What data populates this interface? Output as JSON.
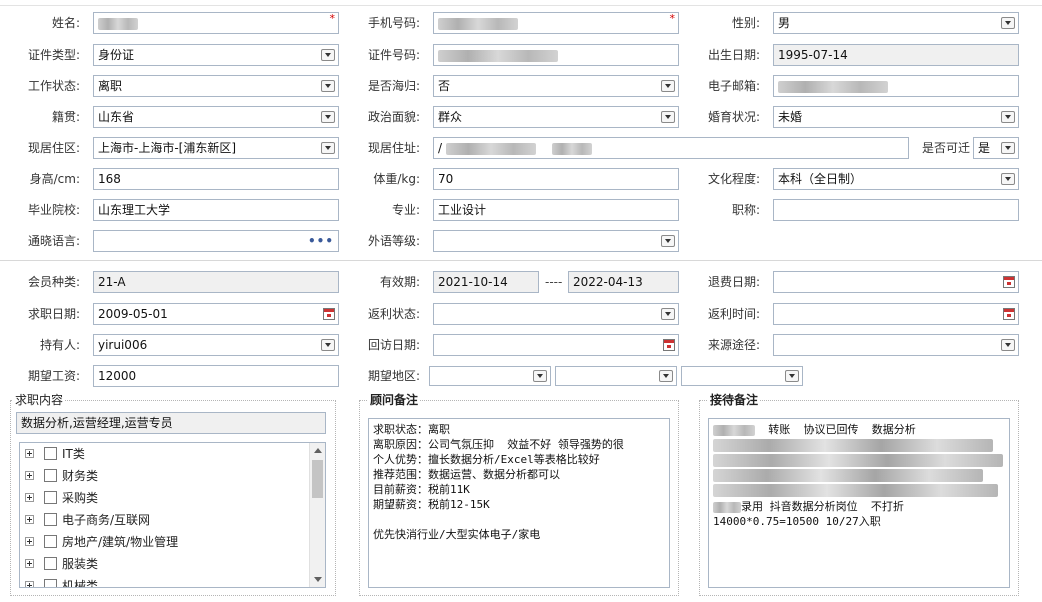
{
  "basic": {
    "name": {
      "label": "姓名:",
      "value": ""
    },
    "phone": {
      "label": "手机号码:",
      "value": ""
    },
    "gender": {
      "label": "性别:",
      "value": "男"
    },
    "id_type": {
      "label": "证件类型:",
      "value": "身份证"
    },
    "id_no": {
      "label": "证件号码:",
      "value": ""
    },
    "birth": {
      "label": "出生日期:",
      "value": "1995-07-14"
    },
    "work_status": {
      "label": "工作状态:",
      "value": "离职"
    },
    "overseas": {
      "label": "是否海归:",
      "value": "否"
    },
    "email": {
      "label": "电子邮箱:",
      "value": ""
    },
    "native": {
      "label": "籍贯:",
      "value": "山东省"
    },
    "political": {
      "label": "政治面貌:",
      "value": "群众"
    },
    "marital": {
      "label": "婚育状况:",
      "value": "未婚"
    },
    "district": {
      "label": "现居住区:",
      "value": "上海市-上海市-[浦东新区]"
    },
    "address": {
      "label": "现居住址:",
      "value": "/"
    },
    "relocate": {
      "label": "是否可迁",
      "value": "是"
    },
    "height": {
      "label": "身高/cm:",
      "value": "168"
    },
    "weight": {
      "label": "体重/kg:",
      "value": "70"
    },
    "education": {
      "label": "文化程度:",
      "value": "本科（全日制）"
    },
    "school": {
      "label": "毕业院校:",
      "value": "山东理工大学"
    },
    "major": {
      "label": "专业:",
      "value": "工业设计"
    },
    "title": {
      "label": "职称:",
      "value": ""
    },
    "language": {
      "label": "通晓语言:",
      "value": "",
      "dots": "•••"
    },
    "foreign_level": {
      "label": "外语等级:",
      "value": ""
    }
  },
  "member": {
    "type": {
      "label": "会员种类:",
      "value": "21-A"
    },
    "validity": {
      "label": "有效期:",
      "start": "2021-10-14",
      "sep": "----",
      "end": "2022-04-13"
    },
    "refund_date": {
      "label": "退费日期:",
      "value": ""
    },
    "apply_date": {
      "label": "求职日期:",
      "value": "2009-05-01"
    },
    "rebate_status": {
      "label": "返利状态:",
      "value": ""
    },
    "rebate_time": {
      "label": "返利时间:",
      "value": ""
    },
    "holder": {
      "label": "持有人:",
      "value": "yirui006"
    },
    "visit_date": {
      "label": "回访日期:",
      "value": ""
    },
    "source": {
      "label": "来源途径:",
      "value": ""
    },
    "salary": {
      "label": "期望工资:",
      "value": "12000"
    },
    "area": {
      "label": "期望地区:",
      "values": [
        "",
        "",
        ""
      ]
    }
  },
  "job_panel": {
    "title": "求职内容",
    "summary": "数据分析,运营经理,运营专员",
    "categories": [
      "IT类",
      "财务类",
      "采购类",
      "电子商务/互联网",
      "房地产/建筑/物业管理",
      "服装类",
      "机械类"
    ]
  },
  "advisor_panel": {
    "title": "顾问备注",
    "lines": [
      "求职状态：离职",
      "离职原因：公司气氛压抑  效益不好 领导强势的很",
      "个人优势：擅长数据分析/Excel等表格比较好",
      "推荐范围：数据运营、数据分析都可以",
      "目前薪资：税前11K",
      "期望薪资：税前12-15K",
      "",
      "优先快消行业/大型实体电子/家电"
    ]
  },
  "reception_panel": {
    "title": "接待备注",
    "line1": "转账  协议已回传  数据分析",
    "line2": "录用 抖音数据分析岗位  不打折",
    "line3": "14000*0.75=10500 10/27入职"
  },
  "colors": {
    "border": "#a9b6c6",
    "readonly_bg": "#f0f0f0",
    "required": "#d40000"
  },
  "icons": [
    "dropdown-arrow-icon",
    "calendar-icon",
    "ellipsis-icon",
    "tree-expand-icon",
    "checkbox-icon"
  ]
}
